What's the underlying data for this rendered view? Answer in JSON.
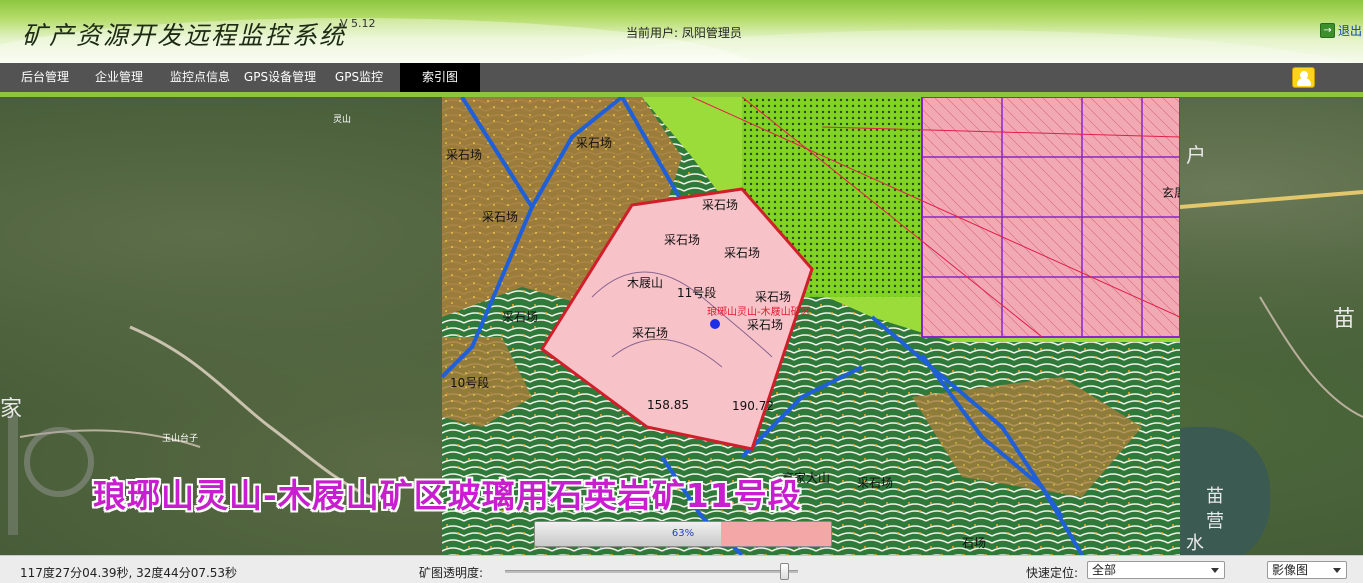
{
  "header": {
    "app_title": "矿产资源开发远程监控系统",
    "version": "V 5.12",
    "current_user": "当前用户: 凤阳管理员",
    "logout_label": "退出"
  },
  "nav": {
    "items": [
      {
        "label": "后台管理",
        "active": false
      },
      {
        "label": "企业管理",
        "active": false
      },
      {
        "label": "监控点信息",
        "active": false
      },
      {
        "label": "GPS设备管理",
        "active": false
      },
      {
        "label": "GPS监控",
        "active": false
      },
      {
        "label": "索引图",
        "active": true
      }
    ]
  },
  "map": {
    "labels": {
      "lingshan": "灵山",
      "yushan_taizi": "玉山台子",
      "jia": "家",
      "miao1": "苗",
      "miao2": "苗",
      "ying": "营",
      "shui": "水",
      "hu": "户"
    },
    "mine_caption": "琅琊山灵山-木屐山矿区玻璃用石英岩矿11号段",
    "load_progress_text": "63%",
    "load_progress_value": 0.63
  },
  "statusbar": {
    "coordinates": "117度27分04.39秒, 32度44分07.53秒",
    "opacity_label": "矿图透明度:",
    "opacity_value": 0.97,
    "quick_locate_label": "快速定位:",
    "quick_locate_value": "全部",
    "basemap_value": "影像图"
  }
}
